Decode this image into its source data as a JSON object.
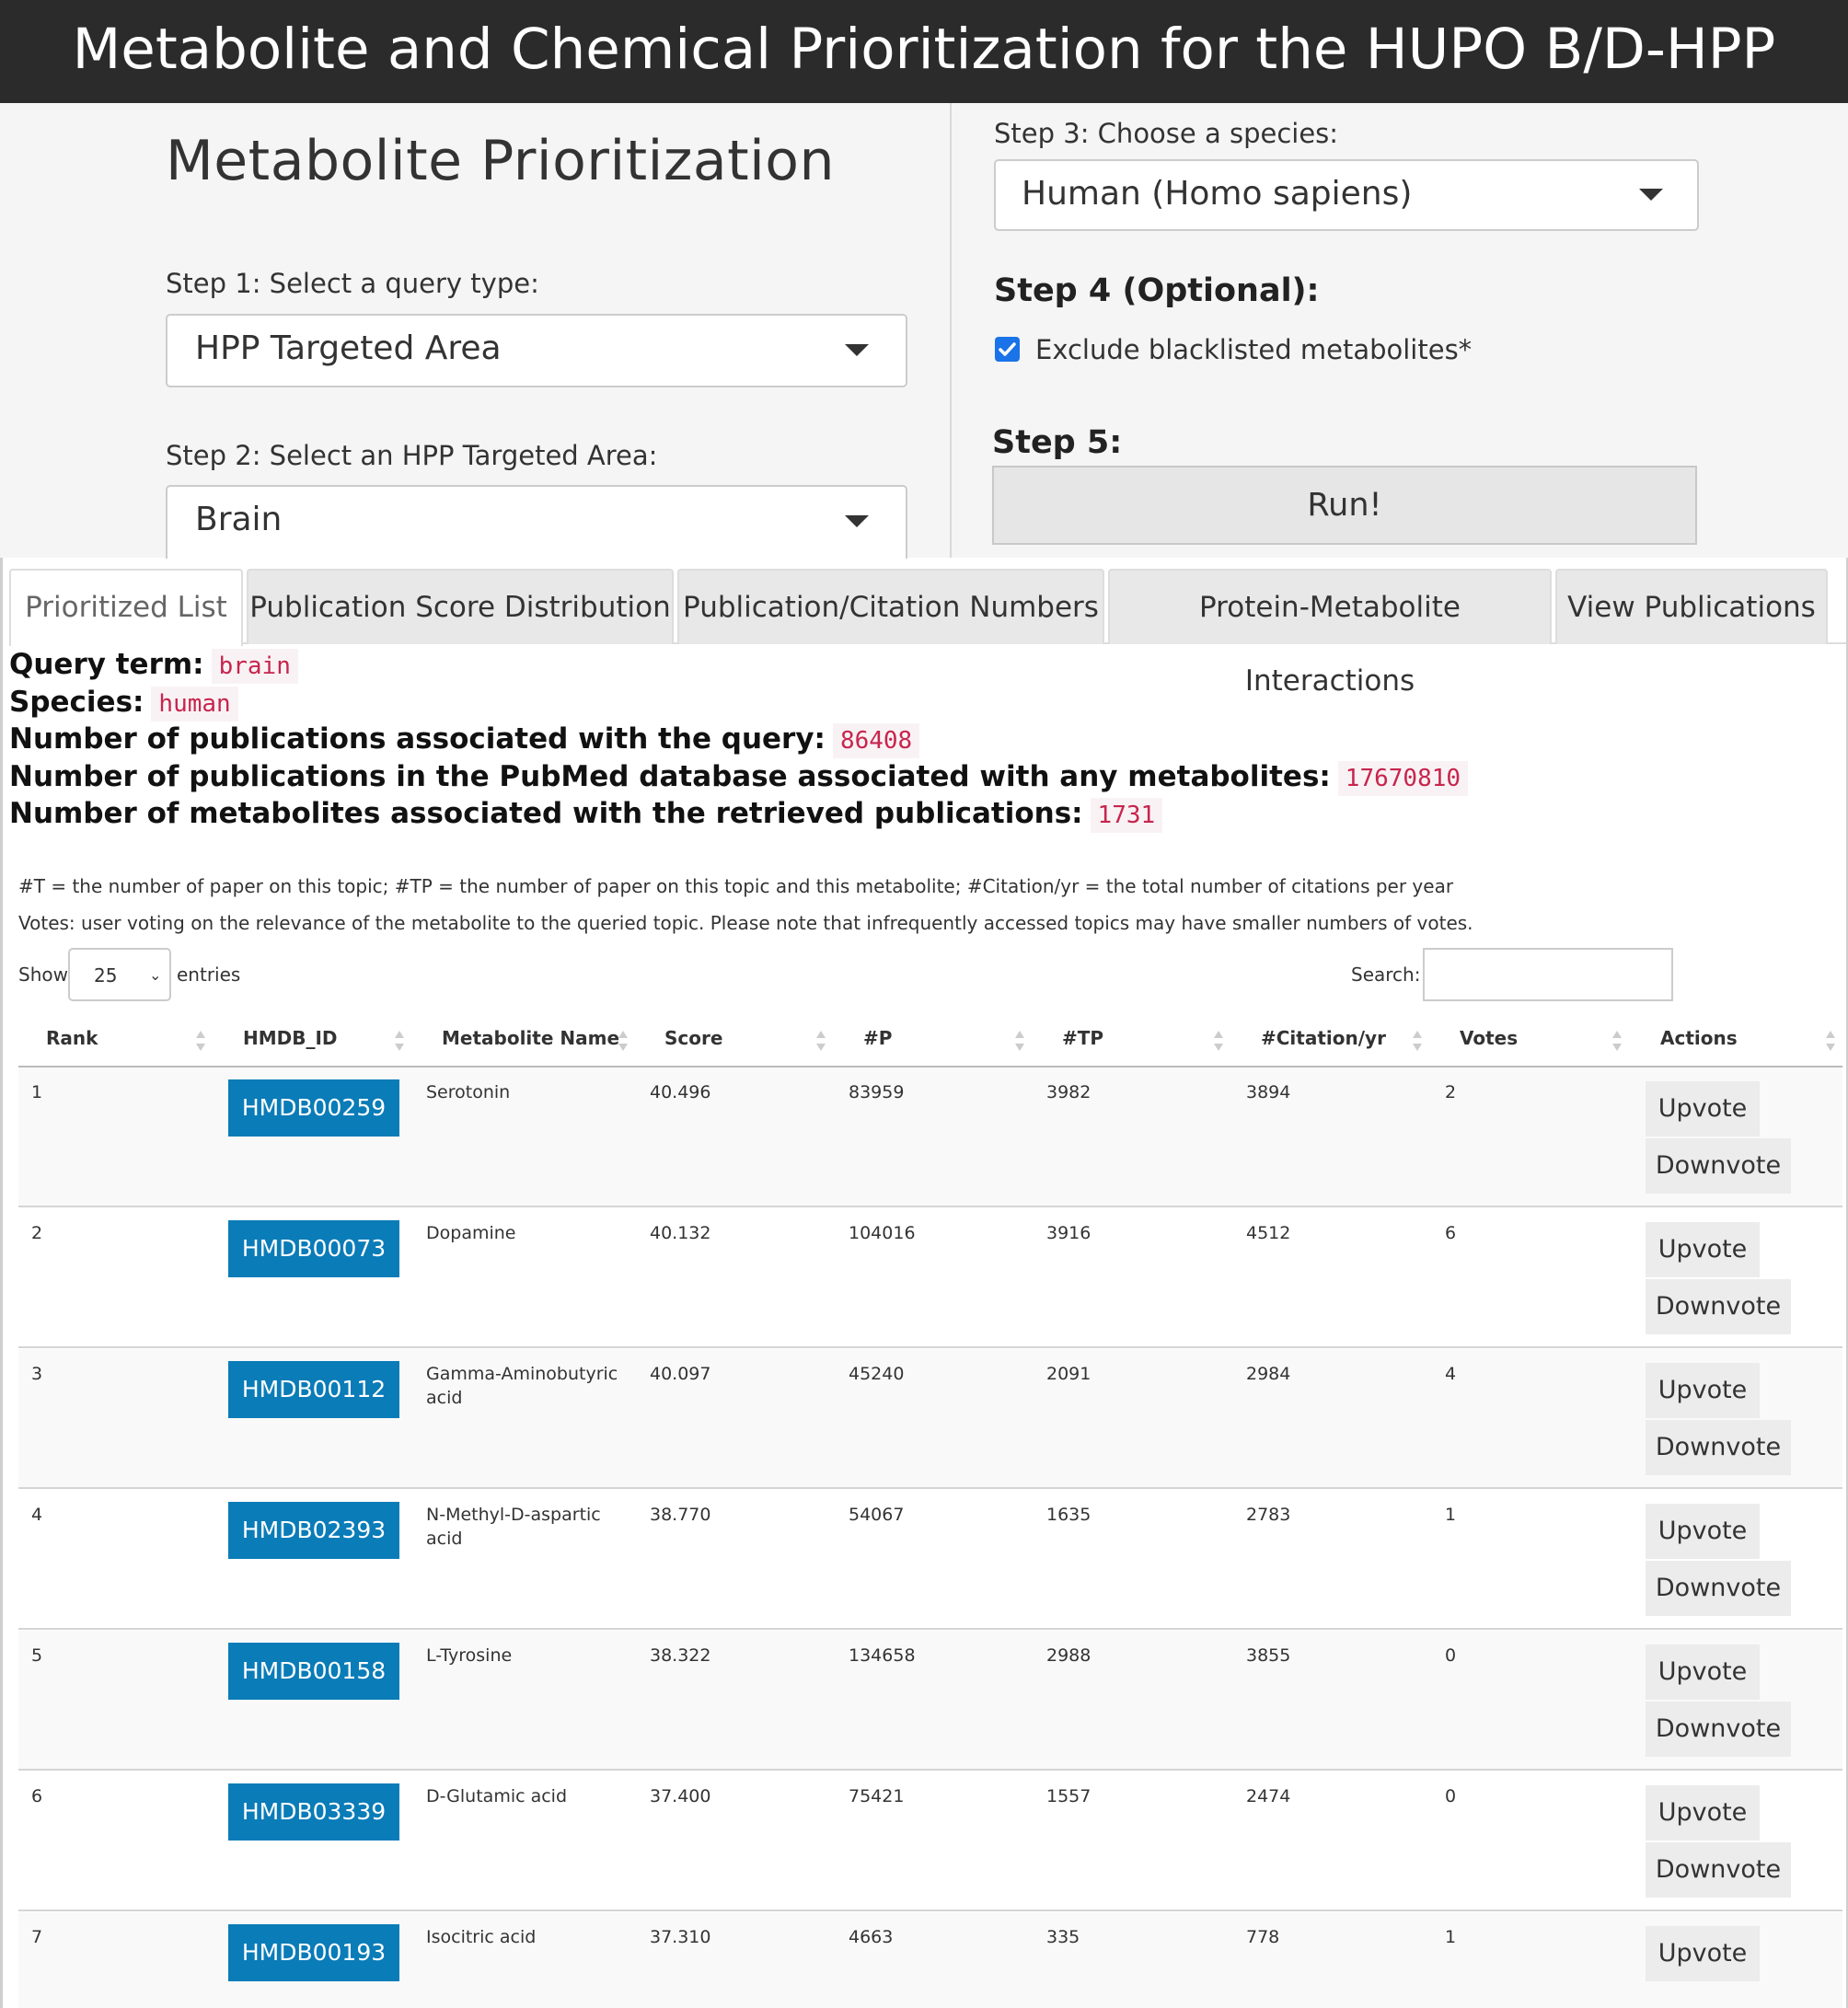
{
  "header": {
    "title": "Metabolite and Chemical Prioritization for the HUPO B/D-HPP"
  },
  "form": {
    "section_title": "Metabolite Prioritization",
    "step1_label": "Step 1: Select a query type:",
    "step1_value": "HPP Targeted Area",
    "step2_label": "Step 2: Select an HPP Targeted Area:",
    "step2_value": "Brain",
    "step3_label": "Step 3: Choose a species:",
    "step3_value": "Human (Homo sapiens)",
    "step4_heading": "Step 4 (Optional):",
    "step4_checkbox_label": "Exclude blacklisted metabolites*",
    "step4_checked": true,
    "step5_heading": "Step 5:",
    "run_label": "Run!"
  },
  "tabs": [
    {
      "label": "Prioritized List",
      "active": true
    },
    {
      "label": "Publication Score Distribution",
      "active": false
    },
    {
      "label": "Publication/Citation Numbers",
      "active": false
    },
    {
      "label": "Protein-Metabolite Interactions",
      "active": false
    },
    {
      "label": "View Publications",
      "active": false
    }
  ],
  "summary": {
    "query_term_label": "Query term:",
    "query_term_value": "brain",
    "species_label": "Species:",
    "species_value": "human",
    "pubs_query_label": "Number of publications associated with the query:",
    "pubs_query_value": "86408",
    "pubs_pubmed_label": "Number of publications in the PubMed database associated with any metabolites:",
    "pubs_pubmed_value": "17670810",
    "metabolites_label": "Number of metabolites associated with the retrieved publications:",
    "metabolites_value": "1731"
  },
  "notes": {
    "legend": "#T = the number of paper on this topic; #TP = the number of paper on this topic and this metabolite; #Citation/yr = the total number of citations per year",
    "votes": "Votes: user voting on the relevance of the metabolite to the queried topic. Please note that infrequently accessed topics may have smaller numbers of votes."
  },
  "controls": {
    "show_label": "Show",
    "length_value": "25",
    "entries_label": "entries",
    "search_label": "Search:",
    "search_value": ""
  },
  "table": {
    "columns": [
      "Rank",
      "HMDB_ID",
      "Metabolite Name",
      "Score",
      "#P",
      "#TP",
      "#Citation/yr",
      "Votes",
      "Actions"
    ],
    "upvote_label": "Upvote",
    "downvote_label": "Downvote",
    "rows": [
      {
        "rank": "1",
        "hmdb_id": "HMDB00259",
        "name": "Serotonin",
        "score": "40.496",
        "p": "83959",
        "tp": "3982",
        "cit": "3894",
        "votes": "2"
      },
      {
        "rank": "2",
        "hmdb_id": "HMDB00073",
        "name": "Dopamine",
        "score": "40.132",
        "p": "104016",
        "tp": "3916",
        "cit": "4512",
        "votes": "6"
      },
      {
        "rank": "3",
        "hmdb_id": "HMDB00112",
        "name": "Gamma-Aminobutyric acid",
        "score": "40.097",
        "p": "45240",
        "tp": "2091",
        "cit": "2984",
        "votes": "4"
      },
      {
        "rank": "4",
        "hmdb_id": "HMDB02393",
        "name": "N-Methyl-D-aspartic acid",
        "score": "38.770",
        "p": "54067",
        "tp": "1635",
        "cit": "2783",
        "votes": "1"
      },
      {
        "rank": "5",
        "hmdb_id": "HMDB00158",
        "name": "L-Tyrosine",
        "score": "38.322",
        "p": "134658",
        "tp": "2988",
        "cit": "3855",
        "votes": "0"
      },
      {
        "rank": "6",
        "hmdb_id": "HMDB03339",
        "name": "D-Glutamic acid",
        "score": "37.400",
        "p": "75421",
        "tp": "1557",
        "cit": "2474",
        "votes": "0"
      },
      {
        "rank": "7",
        "hmdb_id": "HMDB00193",
        "name": "Isocitric acid",
        "score": "37.310",
        "p": "4663",
        "tp": "335",
        "cit": "778",
        "votes": "1"
      }
    ]
  }
}
